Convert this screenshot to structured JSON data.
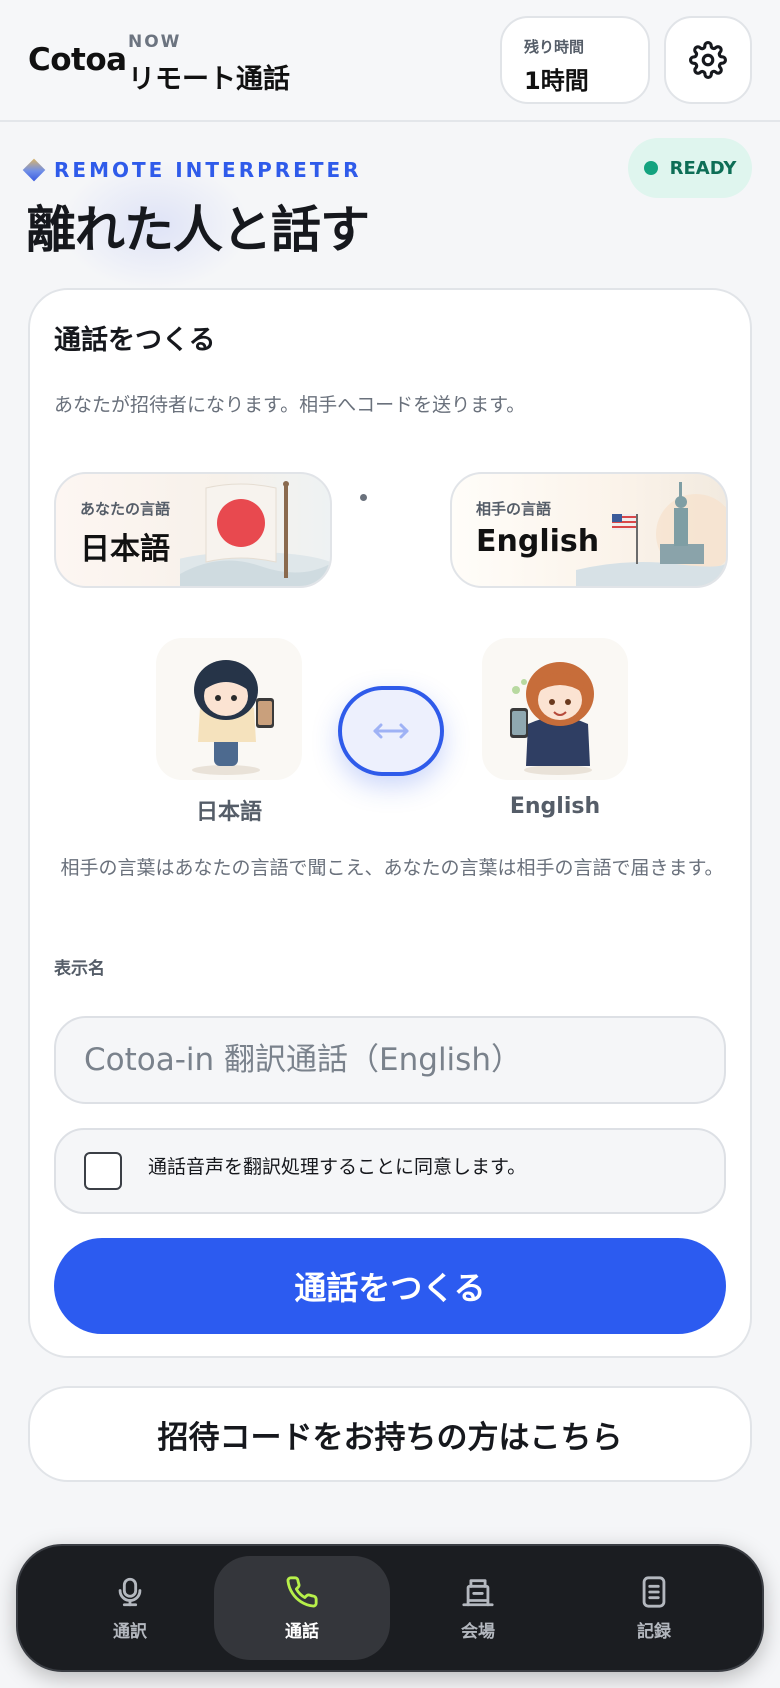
{
  "header": {
    "logo": "Cotoa",
    "now_label": "NOW",
    "mode_title": "リモート通話",
    "time_label": "残り時間",
    "time_value": "1時間"
  },
  "hero": {
    "eyebrow": "REMOTE INTERPRETER",
    "title": "離れた人と話す",
    "status": "READY"
  },
  "colors": {
    "accent": "#2c5bf0",
    "ready": "#14a37f",
    "nav_active_icon": "#b7f04a"
  },
  "card": {
    "title": "通話をつくる",
    "description": "あなたが招待者になります。相手へコードを送ります。",
    "my_language": {
      "label": "あなたの言語",
      "value": "日本語",
      "icon": "japan-flag-art"
    },
    "partner_language": {
      "label": "相手の言語",
      "value": "English",
      "icon": "liberty-flag-art"
    },
    "my_name": "日本語",
    "partner_name": "English",
    "swap_icon": "swap-arrows-icon",
    "explanation": "相手の言葉はあなたの言語で聞こえ、あなたの言葉は相手の言語で届きます。",
    "display_name_label": "表示名",
    "display_name_placeholder": "Cotoa-in 翻訳通話（English）",
    "consent_text": "通話音声を翻訳処理することに同意します。",
    "consent_checked": false,
    "primary_button": "通話をつくる"
  },
  "invite_button": "招待コードをお持ちの方はこちら",
  "nav": {
    "items": [
      {
        "label": "通訳",
        "icon": "microphone-icon",
        "active": false
      },
      {
        "label": "通話",
        "icon": "phone-icon",
        "active": true
      },
      {
        "label": "会場",
        "icon": "venue-icon",
        "active": false
      },
      {
        "label": "記録",
        "icon": "record-icon",
        "active": false
      }
    ]
  }
}
